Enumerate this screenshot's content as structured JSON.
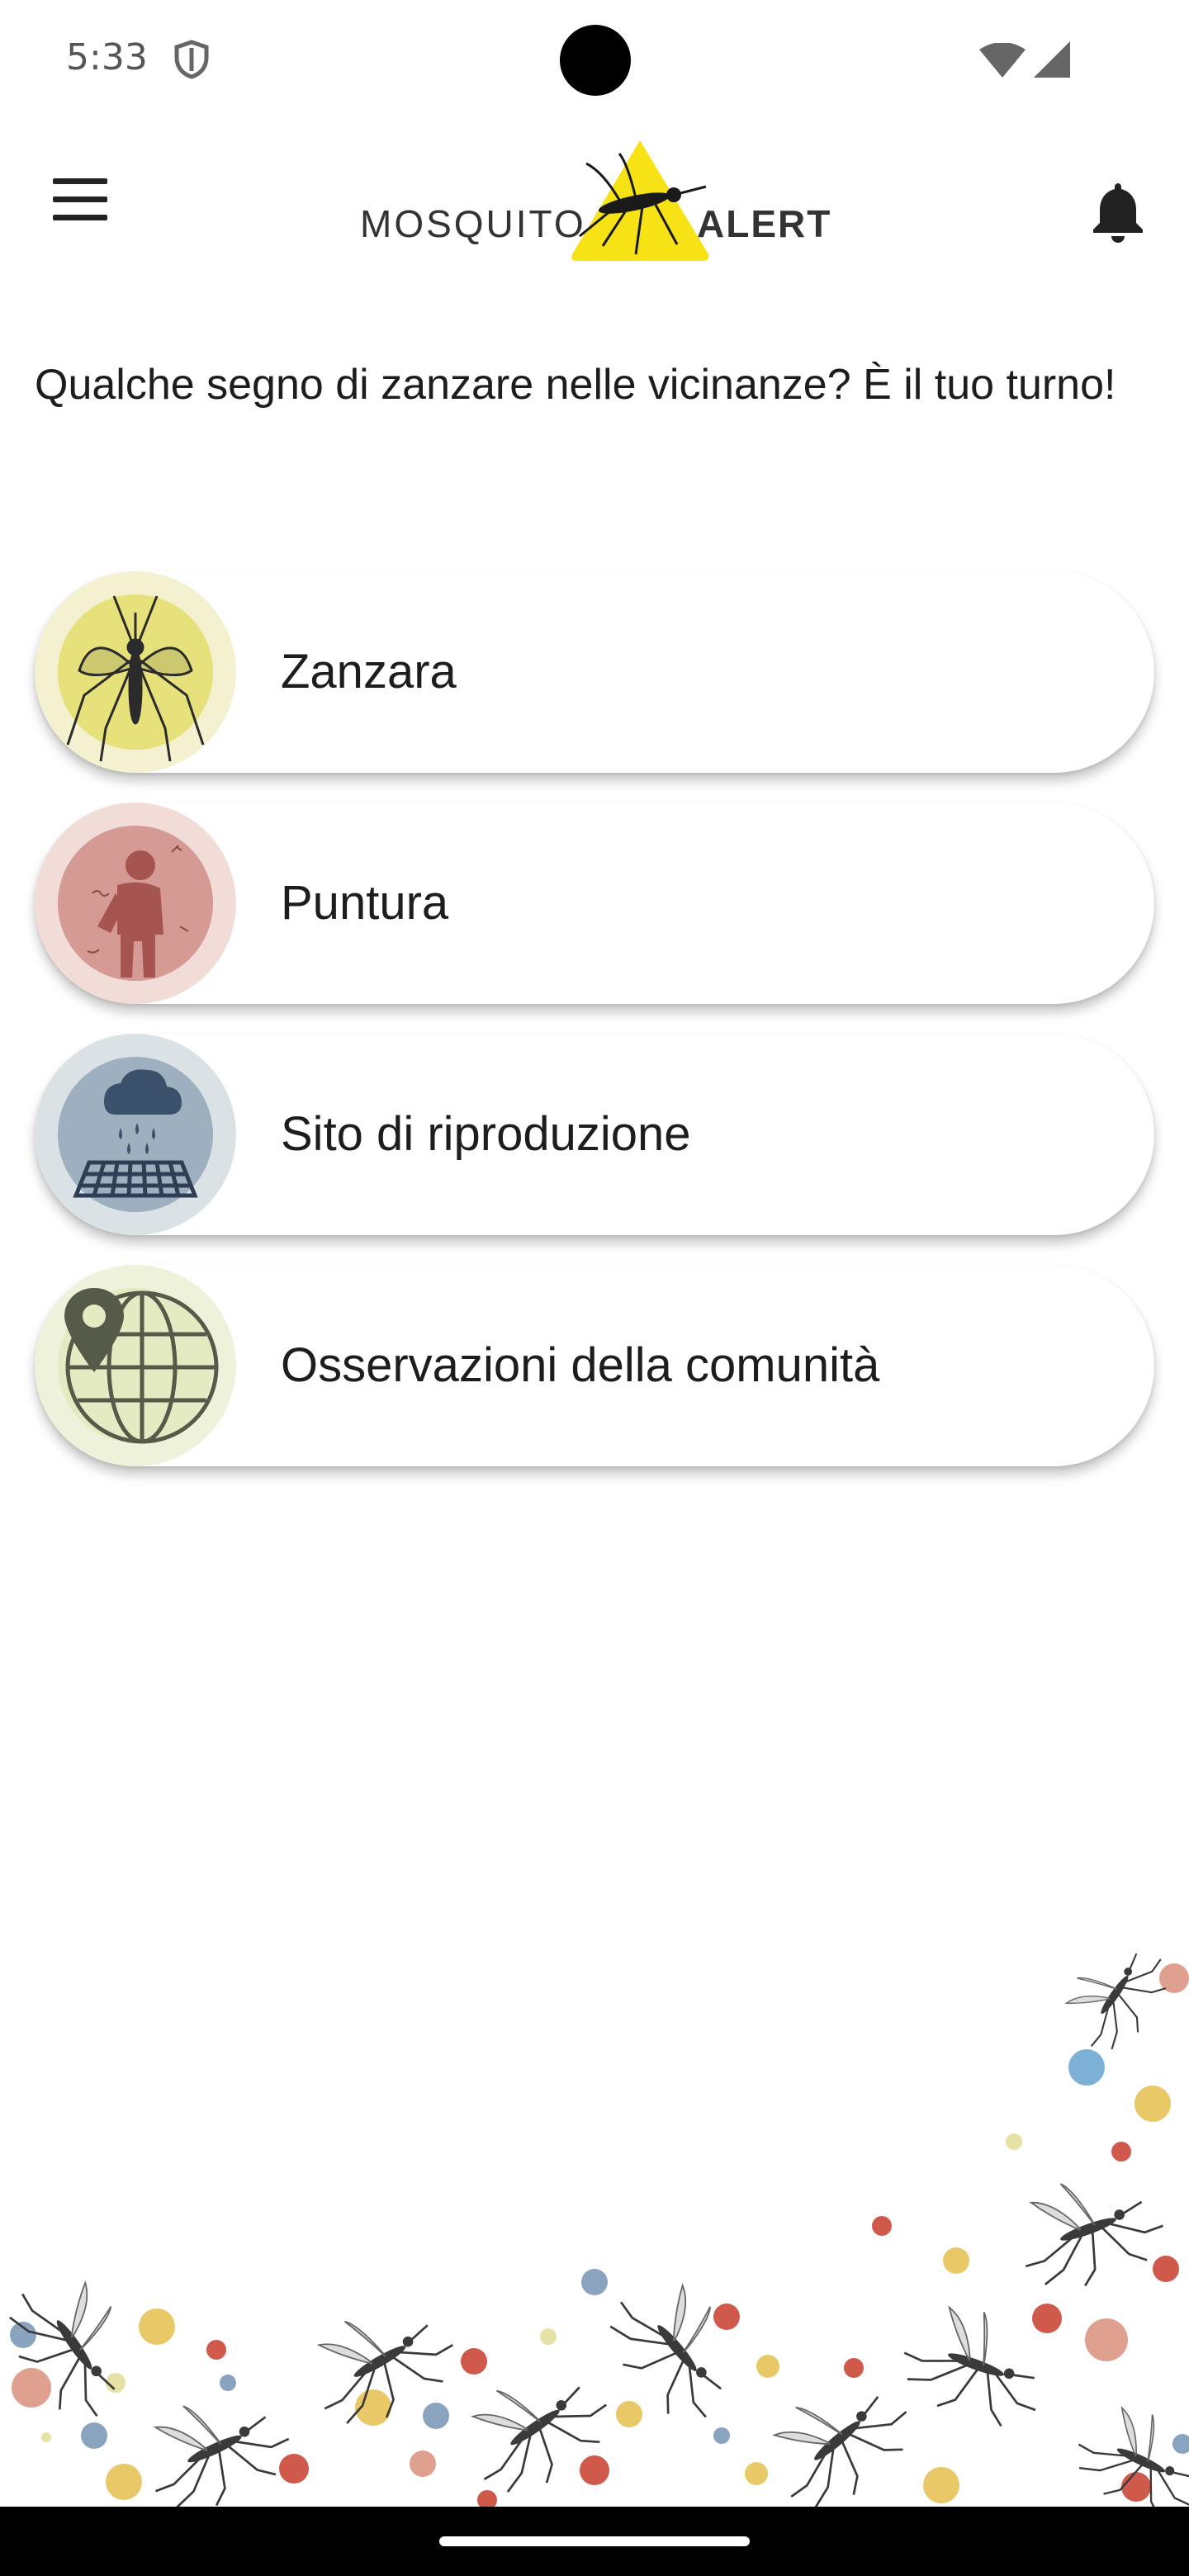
{
  "status_bar": {
    "time": "5:33",
    "icons": [
      "shield-icon",
      "wifi-icon",
      "cell-signal-icon"
    ]
  },
  "app_bar": {
    "menu_icon": "hamburger-menu-icon",
    "logo": {
      "left": "MOSQUITO",
      "right": "ALERT"
    },
    "notifications_icon": "bell-icon"
  },
  "intro": "Qualche segno di zanzare nelle vicinanze? È il tuo turno!",
  "cards": [
    {
      "label": "Zanzara",
      "icon": "mosquito-icon",
      "color": "#e6e17a"
    },
    {
      "label": "Puntura",
      "icon": "bite-person-icon",
      "color": "#d49a93"
    },
    {
      "label": "Sito di riproduzione",
      "icon": "breeding-site-rain-icon",
      "color": "#9eb0bf"
    },
    {
      "label": "Osservazioni della comunità",
      "icon": "map-pin-globe-icon",
      "color": "#e4ebc3"
    }
  ],
  "colors": {
    "logo_yellow": "#f7e315",
    "text": "#1d1d1d",
    "dot_red": "#cf5a4c",
    "dot_yellow": "#e8c867",
    "dot_blue": "#7d9fc2"
  }
}
